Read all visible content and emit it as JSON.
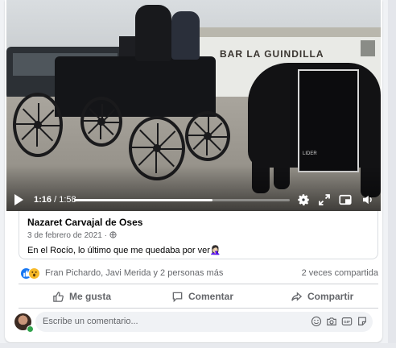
{
  "video": {
    "sign_text": "BAR LA GUINDILLA",
    "blanket_text": "LIDER",
    "current_time": "1:16",
    "separator": " / ",
    "total_time": "1:58",
    "progress": 0.643
  },
  "post": {
    "author": "Nazaret Carvajal de Oses",
    "date": "3 de febrero de 2021",
    "date_separator": " · ",
    "text": "En el Rocío, lo último que me quedaba por ver🤦🏻‍♀️"
  },
  "reactions": {
    "names": "Fran Pichardo, Javi Merida y 2 personas más",
    "shares": "2 veces compartida"
  },
  "actions": {
    "like": "Me gusta",
    "comment": "Comentar",
    "share": "Compartir"
  },
  "comment": {
    "placeholder": "Escribe un comentario..."
  },
  "colors": {
    "accent": "#1877f2",
    "online": "#31a24c",
    "secondary_text": "#65676b"
  }
}
